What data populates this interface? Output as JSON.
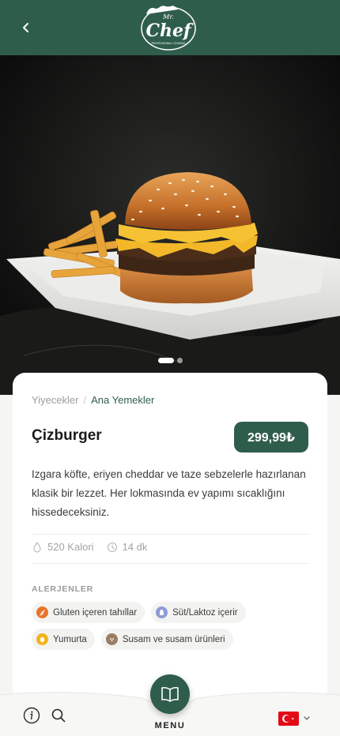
{
  "header": {
    "logo_text": "Mr. Chef",
    "logo_subtext": "PROFESSIONAL COOKING"
  },
  "hero": {
    "image": "burger-with-fries-photo",
    "slides_total": 2,
    "slide_active": 1
  },
  "breadcrumb": {
    "parent": "Yiyecekler",
    "separator": "/",
    "current": "Ana Yemekler"
  },
  "product": {
    "name": "Çizburger",
    "price": "299,99₺",
    "description": "Izgara köfte, eriyen cheddar ve taze sebzelerle hazırlanan klasik bir lezzet. Her lokmasında ev yapımı sıcaklığını hissedeceksiniz.",
    "calories": "520 Kalori",
    "time": "14 dk"
  },
  "allergens": {
    "title": "ALERJENLER",
    "items": [
      {
        "label": "Gluten içeren tahıllar",
        "icon": "wheat-icon",
        "color": "#e8742a"
      },
      {
        "label": "Süt/Laktoz içerir",
        "icon": "milk-icon",
        "color": "#8d9ad6"
      },
      {
        "label": "Yumurta",
        "icon": "egg-icon",
        "color": "#f1b51c"
      },
      {
        "label": "Susam ve susam ürünleri",
        "icon": "sesame-icon",
        "color": "#9a7d63"
      }
    ]
  },
  "bottom_nav": {
    "menu_label": "MENU",
    "language": "TR"
  },
  "colors": {
    "brand": "#2f5d4c",
    "background": "#f5f5f4"
  }
}
